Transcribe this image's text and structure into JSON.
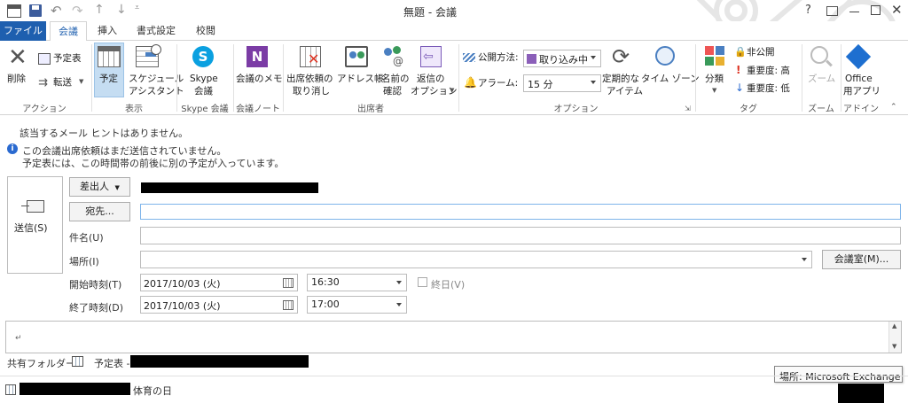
{
  "window": {
    "title": "無題 - 会議",
    "help": "?"
  },
  "tabs": [
    {
      "label": "ファイル"
    },
    {
      "label": "会議"
    },
    {
      "label": "挿入"
    },
    {
      "label": "書式設定"
    },
    {
      "label": "校閲"
    }
  ],
  "ribbon": {
    "action": {
      "delete": "削除",
      "calendar": "予定表",
      "forward": "転送",
      "group": "アクション"
    },
    "view": {
      "appointment": "予定",
      "scheduling": [
        "スケジュール",
        "アシスタント"
      ],
      "group": "表示"
    },
    "skype": {
      "meeting": [
        "Skype",
        "会議"
      ],
      "group": "Skype 会議"
    },
    "notes": {
      "memo": "会議のメモ",
      "group": "会議ノート"
    },
    "attendees": {
      "cancel": [
        "出席依頼の",
        "取り消し"
      ],
      "address_book": "アドレス帳",
      "check_names": [
        "名前の",
        "確認"
      ],
      "response": [
        "返信の",
        "オプション"
      ],
      "group": "出席者"
    },
    "options": {
      "show_as_label": "公開方法:",
      "show_as_value": "取り込み中",
      "reminder_label": "アラーム:",
      "reminder_value": "15 分",
      "recurrence": [
        "定期的な",
        "アイテム"
      ],
      "timezone": "タイム ゾーン",
      "group": "オプション"
    },
    "tags": {
      "categorize": "分類",
      "private": "非公開",
      "high": "重要度: 高",
      "low": "重要度: 低",
      "group": "タグ"
    },
    "zoom": {
      "zoom": "ズーム",
      "group": "ズーム"
    },
    "addin": {
      "office": [
        "Office",
        "用アプリ"
      ],
      "group": "アドイン"
    }
  },
  "info": {
    "hint": "該当するメール ヒントはありません。",
    "line1": "この会議出席依頼はまだ送信されていません。",
    "line2": "予定表には、この時間帯の前後に別の予定が入っています。"
  },
  "form": {
    "send": "送信(S)",
    "from": "差出人",
    "to": "宛先...",
    "subject_label": "件名(U)",
    "location_label": "場所(I)",
    "rooms": "会議室(M)...",
    "start_label": "開始時刻(T)",
    "end_label": "終了時刻(D)",
    "start_date": "2017/10/03 (火)",
    "start_time": "16:30",
    "end_date": "2017/10/03 (火)",
    "end_time": "17:00",
    "allday": "終日(V)",
    "body_mark": "↵"
  },
  "bottom": {
    "shared_folder": "共有フォルダー",
    "calendar": "予定表 -",
    "tooltip": "場所: Microsoft Exchange",
    "footer_event": "体育の日"
  }
}
